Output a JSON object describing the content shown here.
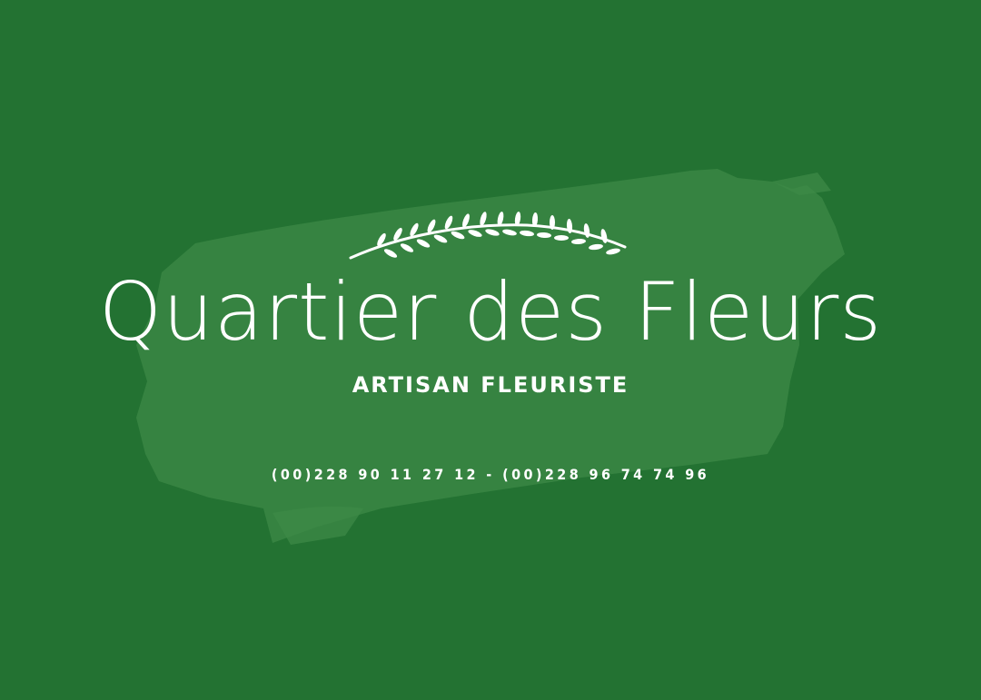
{
  "brand": {
    "name": "Quartier des Fleurs",
    "tagline": "ARTISAN FLEURISTE",
    "phone": "(00)228 90 11 27 12 - (00)228 96 74 74 96"
  },
  "colors": {
    "background": "#237232",
    "brush": "#3d8a47",
    "text": "#ffffff"
  },
  "icons": {
    "ornament": "laurel-branch-icon"
  }
}
